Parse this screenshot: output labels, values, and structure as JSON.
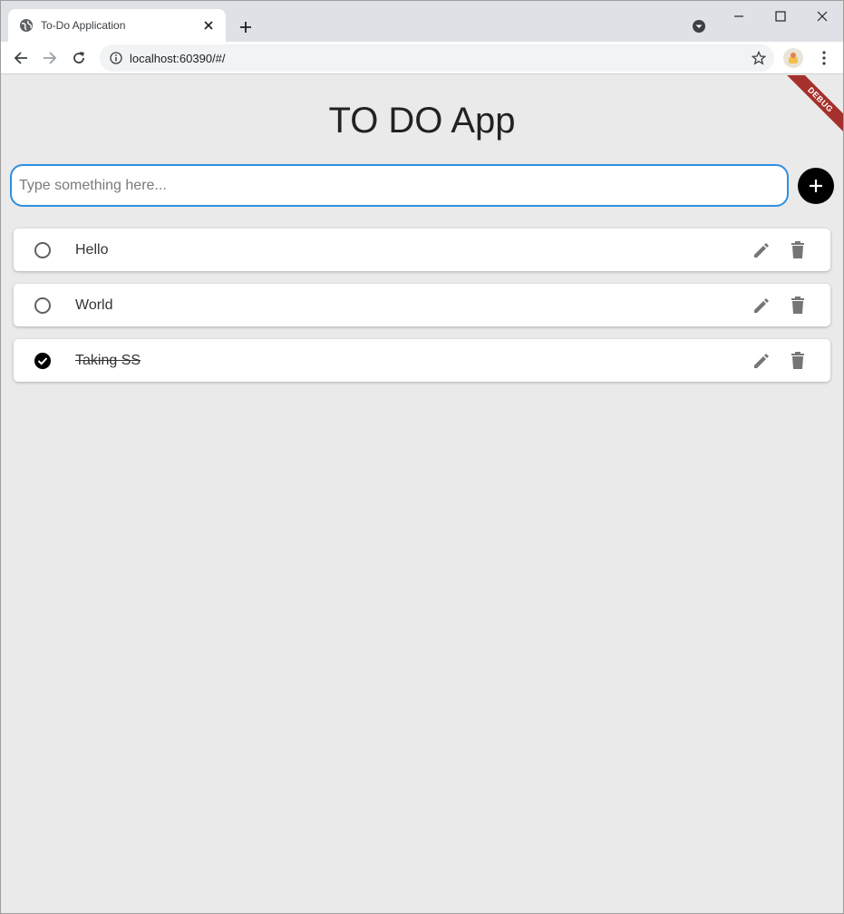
{
  "browser": {
    "tab_title": "To-Do Application",
    "url": "localhost:60390/#/"
  },
  "app": {
    "title": "TO DO App",
    "debug_label": "DEBUG",
    "input_placeholder": "Type something here...",
    "input_value": "",
    "todos": [
      {
        "label": "Hello",
        "done": false
      },
      {
        "label": "World",
        "done": false
      },
      {
        "label": "Taking SS",
        "done": true
      }
    ]
  },
  "colors": {
    "accent": "#2f8fe0",
    "background": "#eaeaea",
    "icon_gray": "#757575",
    "debug_banner": "#a6302b"
  }
}
